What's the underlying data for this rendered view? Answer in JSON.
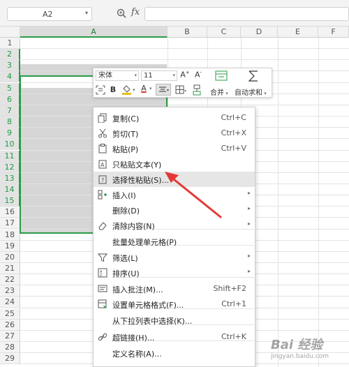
{
  "formula_bar": {
    "name_box": "A2",
    "fx": "fx",
    "formula": ""
  },
  "columns": [
    "A",
    "B",
    "C",
    "D",
    "E",
    "F"
  ],
  "rows": [
    "1",
    "2",
    "3",
    "4",
    "5",
    "6",
    "7",
    "8",
    "9",
    "10",
    "11",
    "12",
    "13",
    "14",
    "15",
    "16",
    "17",
    "18",
    "19",
    "20",
    "21",
    "22",
    "23",
    "24",
    "25",
    "26",
    "27",
    "28",
    "29"
  ],
  "selection": {
    "active_cell": "A2",
    "range": "A2:A15"
  },
  "mini_toolbar": {
    "font": "宋体",
    "size": "11",
    "bold": "B",
    "font_color_letter": "A",
    "merge_label": "合并",
    "autosum_label": "自动求和",
    "fill_color": "#e8c11a",
    "font_color": "#d83b2b"
  },
  "context_menu": {
    "items": [
      {
        "label": "复制(C)",
        "shortcut": "Ctrl+C",
        "icon": "copy-icon"
      },
      {
        "label": "剪切(T)",
        "shortcut": "Ctrl+X",
        "icon": "scissors-icon"
      },
      {
        "label": "粘贴(P)",
        "shortcut": "Ctrl+V",
        "icon": "paste-icon"
      },
      {
        "label": "只粘贴文本(Y)",
        "shortcut": "",
        "icon": "paste-text-icon"
      },
      {
        "label": "选择性粘贴(S)...",
        "shortcut": "",
        "icon": "paste-special-icon",
        "highlighted": true
      },
      {
        "label": "插入(I)",
        "shortcut": "",
        "icon": "insert-icon",
        "submenu": true
      },
      {
        "label": "删除(D)",
        "shortcut": "",
        "icon": "",
        "submenu": true
      },
      {
        "label": "清除内容(N)",
        "shortcut": "",
        "icon": "eraser-icon",
        "submenu": true
      },
      {
        "label": "批量处理单元格(P)",
        "shortcut": "",
        "icon": ""
      },
      {
        "label": "筛选(L)",
        "shortcut": "",
        "icon": "filter-icon",
        "submenu": true
      },
      {
        "label": "排序(U)",
        "shortcut": "",
        "icon": "sort-icon",
        "submenu": true
      },
      {
        "label": "插入批注(M)...",
        "shortcut": "Shift+F2",
        "icon": "comment-icon"
      },
      {
        "label": "设置单元格格式(F)...",
        "shortcut": "Ctrl+1",
        "icon": "format-cells-icon"
      },
      {
        "label": "从下拉列表中选择(K)...",
        "shortcut": "",
        "icon": ""
      },
      {
        "label": "超链接(H)...",
        "shortcut": "Ctrl+K",
        "icon": "link-icon"
      },
      {
        "label": "定义名称(A)...",
        "shortcut": "",
        "icon": ""
      }
    ]
  },
  "annotation": {
    "arrow_color": "#e53935"
  },
  "watermark": {
    "text": "Bai 经验",
    "sub": "jingyan.baidu.com"
  }
}
